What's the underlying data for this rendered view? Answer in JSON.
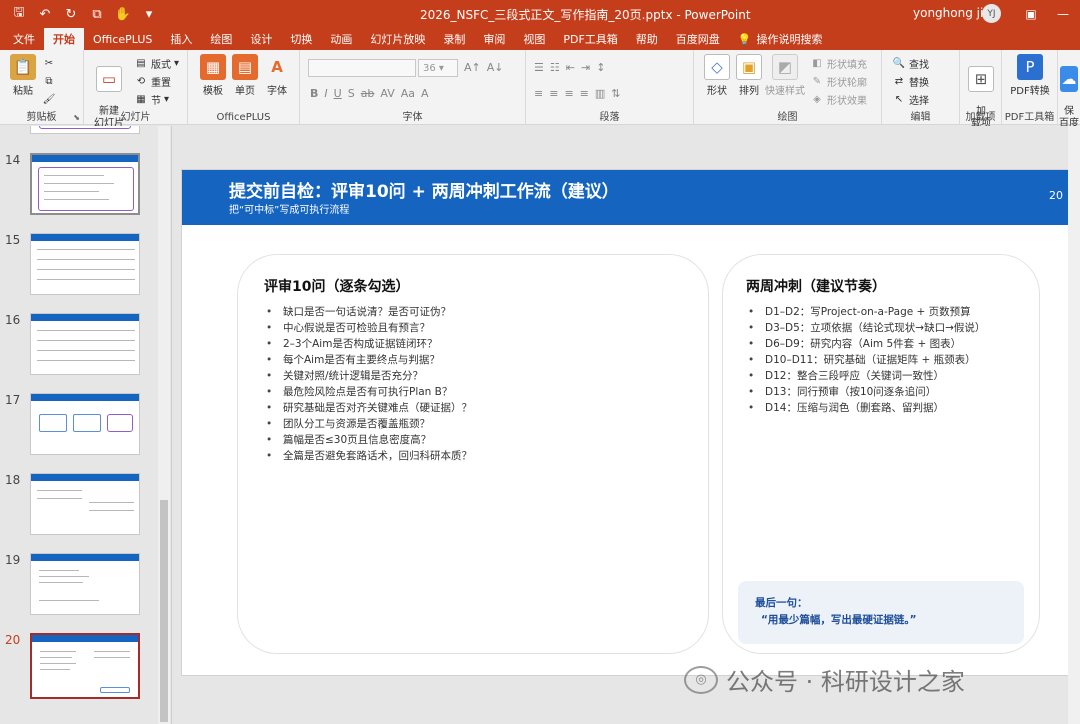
{
  "titlebar": {
    "doc_title": "2026_NSFC_三段式正文_写作指南_20页.pptx  -  PowerPoint",
    "user_name": "yonghong jin",
    "avatar_initials": "YJ",
    "accent_color": "#c43e1c"
  },
  "tabs": [
    "文件",
    "开始",
    "OfficePLUS",
    "插入",
    "绘图",
    "设计",
    "切换",
    "动画",
    "幻灯片放映",
    "录制",
    "审阅",
    "视图",
    "PDF工具箱",
    "帮助",
    "百度网盘"
  ],
  "tell_me": "操作说明搜索",
  "ribbon": {
    "clipboard": {
      "paste": "粘贴",
      "label": "剪贴板"
    },
    "slides": {
      "new_slide": "新建\n幻灯片",
      "layout": "版式",
      "reset": "重置",
      "section": "节",
      "label": "幻灯片"
    },
    "officeplus": {
      "template": "模板",
      "single_page": "单页",
      "font": "字体",
      "label": "OfficePLUS"
    },
    "font": {
      "size": "36",
      "label": "字体"
    },
    "paragraph": {
      "label": "段落"
    },
    "drawing": {
      "shapes": "形状",
      "arrange": "排列",
      "quick_styles": "快速样式",
      "fill": "形状填充",
      "outline": "形状轮廓",
      "effects": "形状效果",
      "label": "绘图"
    },
    "editing": {
      "find": "查找",
      "replace": "替换",
      "select": "选择",
      "label": "编辑"
    },
    "addins": {
      "addin": "加\n载项",
      "label": "加载项"
    },
    "pdf": {
      "convert": "PDF转换",
      "label": "PDF工具箱"
    },
    "extra": {
      "save": "保\n百度"
    }
  },
  "thumbnails": [
    {
      "num": "14"
    },
    {
      "num": "15"
    },
    {
      "num": "16"
    },
    {
      "num": "17"
    },
    {
      "num": "18"
    },
    {
      "num": "19"
    },
    {
      "num": "20"
    }
  ],
  "slide": {
    "title": "提交前自检：评审10问 + 两周冲刺工作流（建议）",
    "subtitle": "把“可中标”写成可执行流程",
    "number": "20",
    "header_color": "#1565c0",
    "left_card": {
      "title": "评审10问（逐条勾选）",
      "items": [
        "缺口是否一句话说清？是否可证伪？",
        "中心假说是否可检验且有预言？",
        "2–3个Aim是否构成证据链闭环？",
        "每个Aim是否有主要终点与判据？",
        "关键对照/统计逻辑是否充分？",
        "最危险风险点是否有可执行Plan B？",
        "研究基础是否对齐关键难点（硬证据）？",
        "团队分工与资源是否覆盖瓶颈？",
        "篇幅是否≤30页且信息密度高？",
        "全篇是否避免套路话术，回归科研本质？"
      ]
    },
    "right_card": {
      "title": "两周冲刺（建议节奏）",
      "items": [
        "D1–D2：写Project-on-a-Page + 页数预算",
        "D3–D5：立项依据（结论式现状→缺口→假说）",
        "D6–D9：研究内容（Aim 5件套 + 图表）",
        "D10–D11：研究基础（证据矩阵 + 瓶颈表）",
        "D12：整合三段呼应（关键词一致性）",
        "D13：同行预审（按10问逐条追问）",
        "D14：压缩与润色（删套路、留判据）"
      ],
      "note_line1": "最后一句：",
      "note_line2": "“用最少篇幅，写出最硬证据链。”"
    }
  },
  "watermark": "公众号 · 科研设计之家"
}
